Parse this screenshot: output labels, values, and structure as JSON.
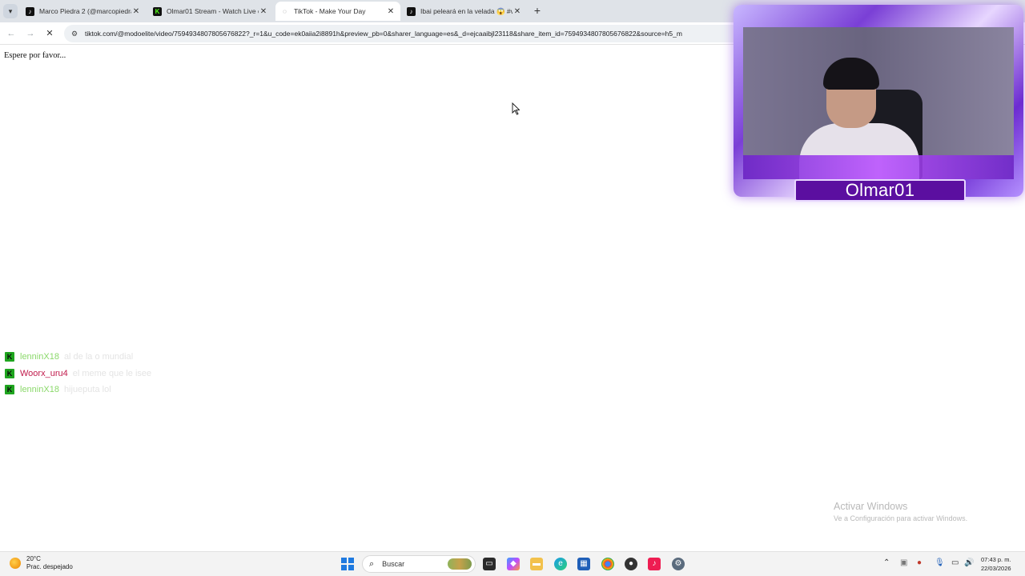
{
  "browser": {
    "tabs": [
      {
        "title": "Marco Piedra 2 (@marcopiedra",
        "favicon": "tiktok-icon",
        "active": false
      },
      {
        "title": "Olmar01 Stream - Watch Live o",
        "favicon": "kick-icon",
        "active": false
      },
      {
        "title": "TikTok - Make Your Day",
        "favicon": "loading-icon",
        "active": true
      },
      {
        "title": "Ibai peleará en la velada 😱 #v",
        "favicon": "tiktok-icon",
        "active": false
      }
    ],
    "new_tab_glyph": "+",
    "url": "tiktok.com/@modoelite/video/7594934807805676822?_r=1&u_code=ek0aiia2i8891h&preview_pb=0&sharer_language=es&_d=ejcaaibjl23118&share_item_id=7594934807805676822&source=h5_m"
  },
  "page": {
    "loading_text": "Espere por favor..."
  },
  "chat": {
    "badge_glyph": "K",
    "messages": [
      {
        "user": "lenninX18",
        "text": "al de la o mundial",
        "user_color": "#8bd96b"
      },
      {
        "user": "Woorx_uru4",
        "text": "el meme que le isee",
        "user_color": "#c01a4b"
      },
      {
        "user": "lenninX18",
        "text": "hijueputa lol",
        "user_color": "#8bd96b"
      }
    ]
  },
  "webcam": {
    "streamer_name": "Olmar01"
  },
  "watermark": {
    "title": "Activar Windows",
    "subtitle": "Ve a Configuración para activar Windows."
  },
  "taskbar": {
    "weather_temp": "20°C",
    "weather_desc": "Prac. despejado",
    "search_placeholder": "Buscar",
    "time": "07:43 p. m.",
    "date": "22/03/2026"
  },
  "colors": {
    "accent_purple": "#5b0fa0",
    "kick_green": "#1fa51f"
  }
}
